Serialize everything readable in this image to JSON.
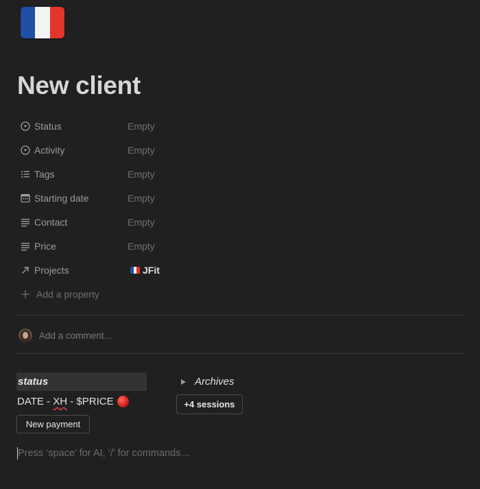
{
  "page": {
    "icon": "french-flag-emoji",
    "title": "New client"
  },
  "colors": {
    "background": "#202020",
    "flag_blue": "#1f4fa6",
    "flag_white": "#f3f3f3",
    "flag_red": "#e2352c"
  },
  "properties": [
    {
      "name": "Status",
      "icon": "status-icon",
      "value": "Empty"
    },
    {
      "name": "Activity",
      "icon": "select-icon",
      "value": "Empty"
    },
    {
      "name": "Tags",
      "icon": "list-icon",
      "value": "Empty"
    },
    {
      "name": "Starting date",
      "icon": "calendar-icon",
      "value": "Empty"
    },
    {
      "name": "Contact",
      "icon": "text-icon",
      "value": "Empty"
    },
    {
      "name": "Price",
      "icon": "text-icon",
      "value": "Empty"
    },
    {
      "name": "Projects",
      "icon": "relation-arrow-icon",
      "value": "JFit",
      "value_icon": "french-flag-emoji"
    }
  ],
  "add_property_label": "Add a property",
  "comment": {
    "placeholder": "Add a comment..."
  },
  "body": {
    "status_heading": "status",
    "date_line_prefix": "DATE - ",
    "date_line_xh": "XH",
    "date_line_suffix": " - $PRICE",
    "new_payment_label": "New payment",
    "archives_label": "Archives",
    "sessions_label": "+4 sessions",
    "editor_placeholder": "Press ‘space’ for AI, ‘/’ for commands…"
  }
}
